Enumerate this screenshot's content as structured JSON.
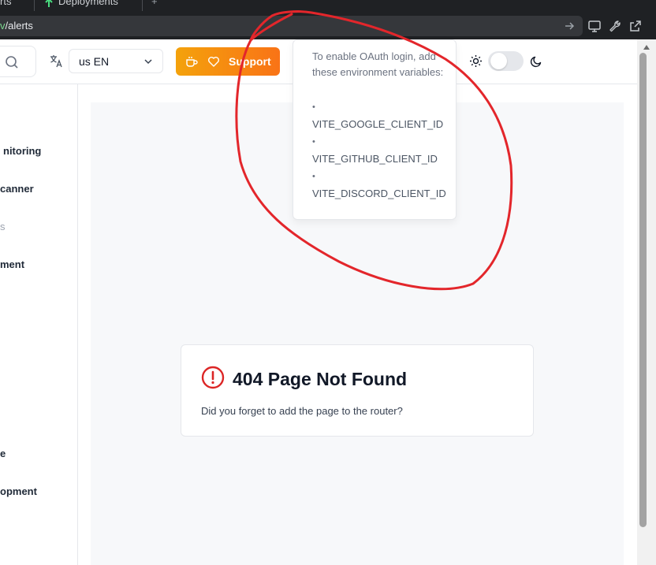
{
  "browser": {
    "tabs": [
      {
        "label": "rts"
      },
      {
        "label": "Deployments"
      }
    ],
    "url_prefix": "v",
    "url_path": "/alerts"
  },
  "header": {
    "language": {
      "value": "us EN"
    },
    "support_label": "Support",
    "theme_toggle_on": false
  },
  "sidebar": {
    "items": [
      {
        "label": "nitoring"
      },
      {
        "label": "canner"
      },
      {
        "label": "s"
      },
      {
        "label": "ment"
      },
      {
        "label": "e"
      },
      {
        "label": "opment"
      }
    ]
  },
  "tooltip": {
    "intro": "To enable OAuth login, add these environment variables:",
    "bullet": "•",
    "vars": [
      "VITE_GOOGLE_CLIENT_ID",
      "VITE_GITHUB_CLIENT_ID",
      "VITE_DISCORD_CLIENT_ID"
    ]
  },
  "error_card": {
    "title": "404 Page Not Found",
    "description": "Did you forget to add the page to the router?"
  },
  "colors": {
    "accent_start": "#f4a20c",
    "accent_end": "#f97316",
    "error": "#dc2626",
    "annotation": "#e3262b"
  },
  "icons": [
    "search-icon",
    "translate-icon",
    "chevron-down-icon",
    "coffee-icon",
    "heart-icon",
    "sun-icon",
    "moon-icon",
    "alert-circle-icon",
    "arrow-right-icon",
    "monitor-icon",
    "wrench-icon",
    "external-link-icon"
  ]
}
